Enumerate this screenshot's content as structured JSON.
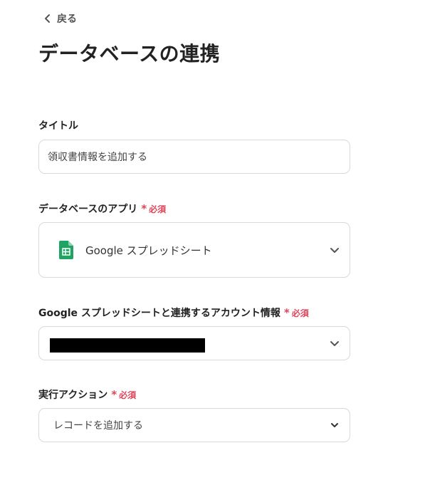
{
  "nav": {
    "back_label": "戻る"
  },
  "page": {
    "title": "データベースの連携"
  },
  "required_label": "必須",
  "form": {
    "title_field": {
      "label": "タイトル",
      "value": "領収書情報を追加する"
    },
    "app_field": {
      "label": "データベースのアプリ",
      "selected_app": "Google スプレッドシート",
      "app_icon": "google-sheets-icon"
    },
    "account_field": {
      "label": "Google スプレッドシートと連携するアカウント情報"
    },
    "action_field": {
      "label": "実行アクション",
      "selected": "レコードを追加する"
    }
  },
  "colors": {
    "required": "#e0455a",
    "sheets_green": "#1fa463",
    "border": "#d9d9d9"
  }
}
